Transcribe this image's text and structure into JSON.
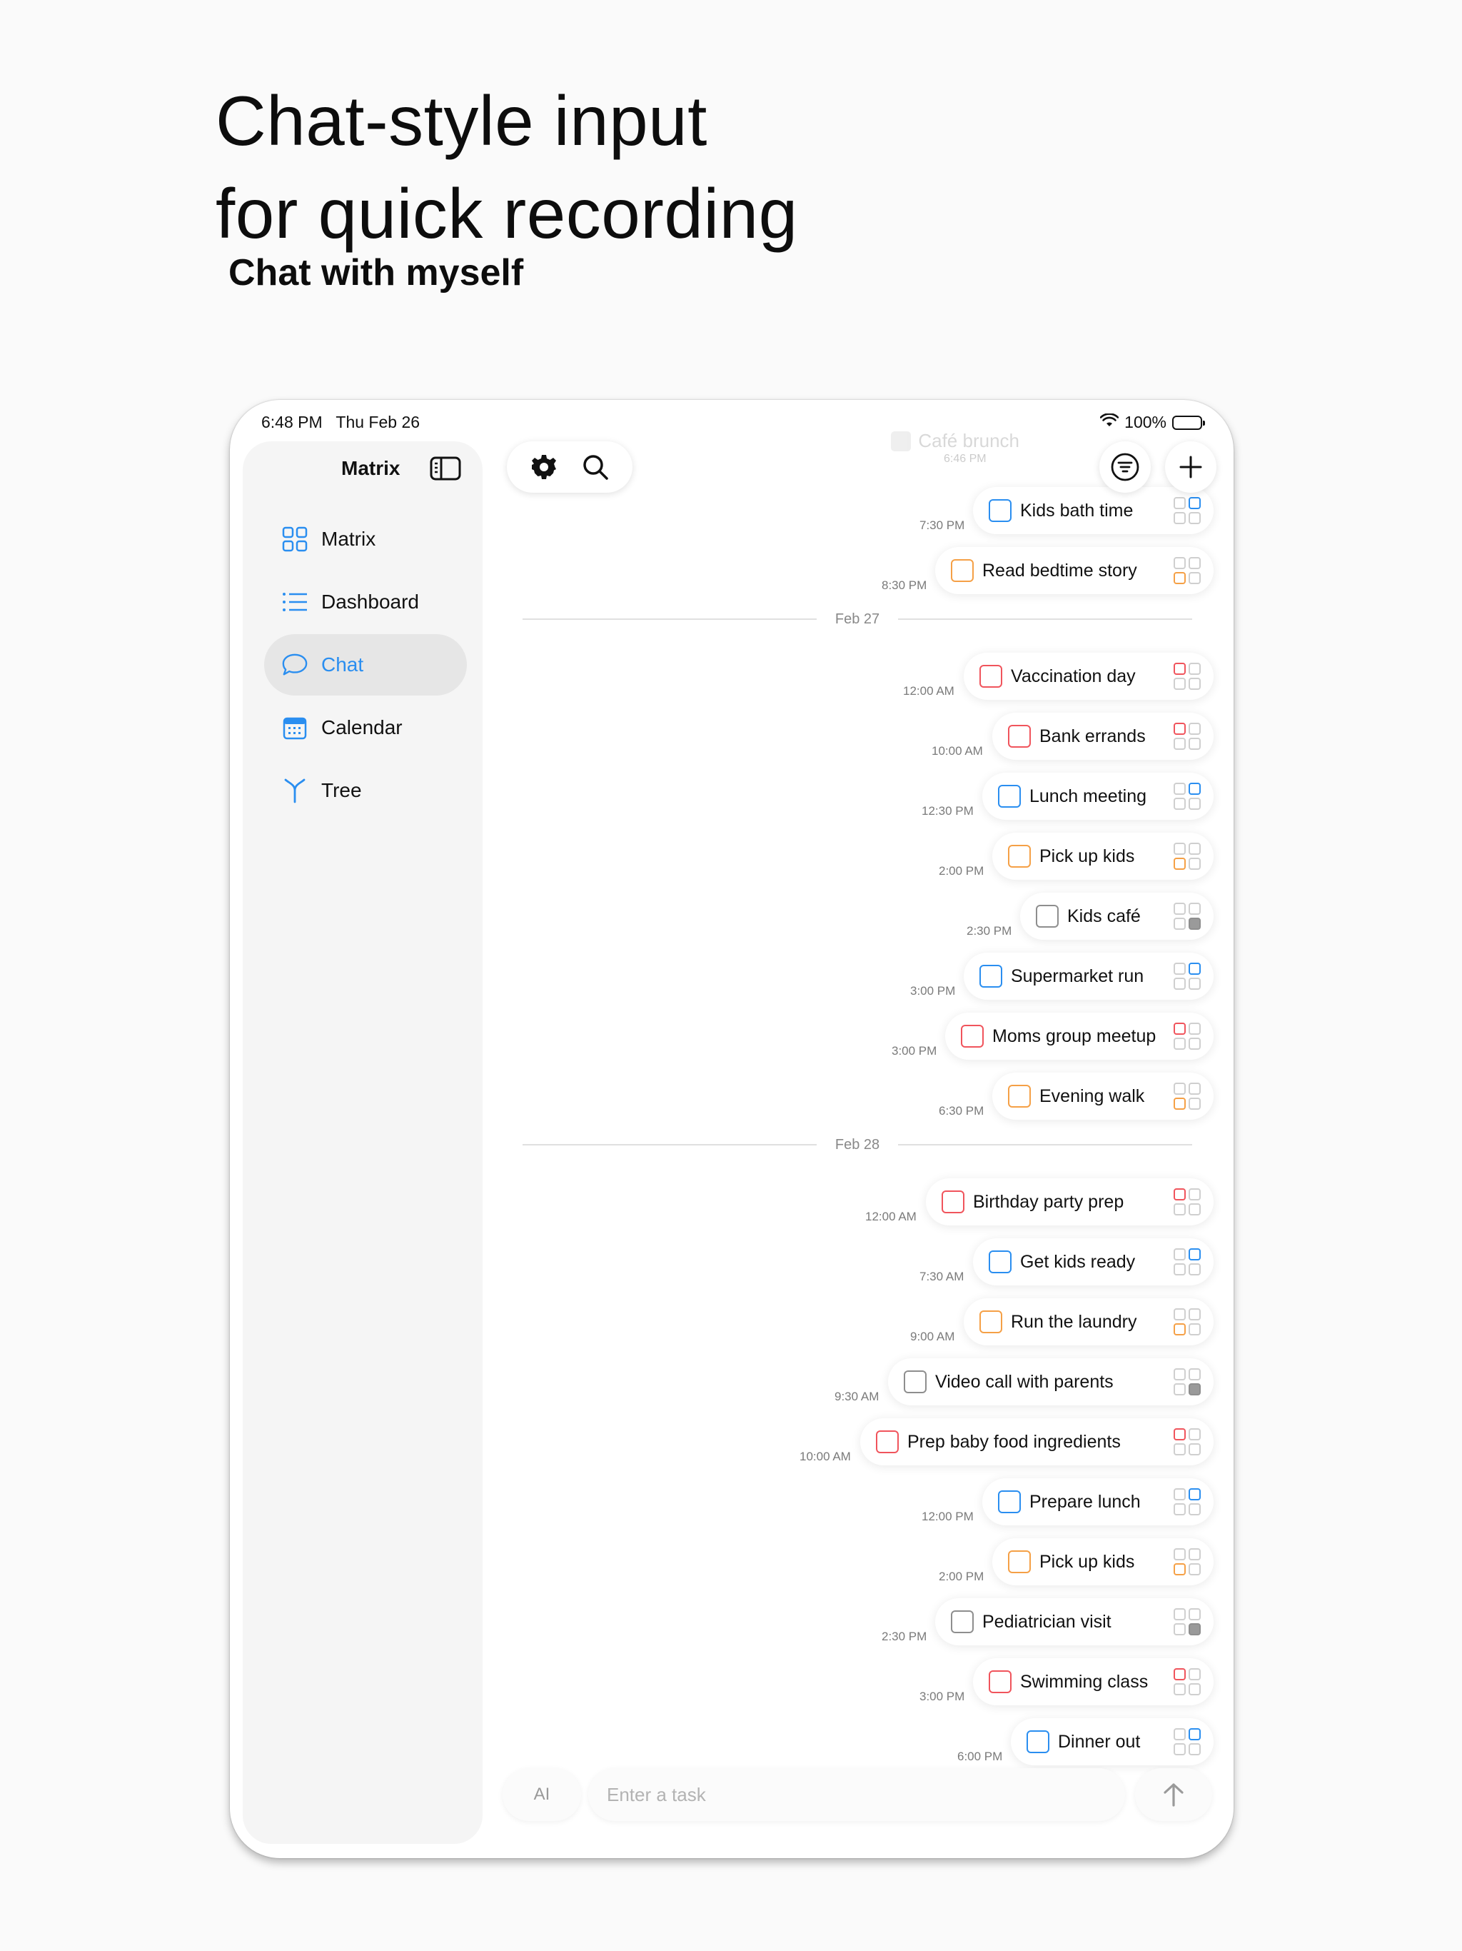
{
  "promo": {
    "headline_line1": "Chat-style input",
    "headline_line2": "for quick recording",
    "subline": "Chat with myself"
  },
  "status_bar": {
    "time": "6:48 PM   Thu Feb 26",
    "battery": "100%"
  },
  "sidebar": {
    "title": "Matrix",
    "items": [
      {
        "label": "Matrix",
        "icon": "grid-icon"
      },
      {
        "label": "Dashboard",
        "icon": "list-icon"
      },
      {
        "label": "Chat",
        "icon": "chat-bubble-icon",
        "active": true
      },
      {
        "label": "Calendar",
        "icon": "calendar-icon"
      },
      {
        "label": "Tree",
        "icon": "tree-branch-icon"
      }
    ]
  },
  "colors": {
    "red": "#f0545c",
    "blue": "#2a8ef0",
    "orange": "#f5a046",
    "gray": "#8e8e8e",
    "accent": "#2a8ef0"
  },
  "chat": {
    "ghost_task": {
      "text": "Café brunch",
      "time": "6:46 PM"
    },
    "groups": [
      {
        "date": "",
        "tasks": [
          {
            "text": "Kids bath time",
            "time": "7:30 PM",
            "color": "blue",
            "quadrant": 1
          },
          {
            "text": "Read bedtime story",
            "time": "8:30 PM",
            "color": "orange",
            "quadrant": 2
          }
        ]
      },
      {
        "date": "Feb 27",
        "tasks": [
          {
            "text": "Vaccination day",
            "time": "12:00 AM",
            "color": "red",
            "quadrant": 0
          },
          {
            "text": "Bank errands",
            "time": "10:00 AM",
            "color": "red",
            "quadrant": 0
          },
          {
            "text": "Lunch meeting",
            "time": "12:30 PM",
            "color": "blue",
            "quadrant": 1
          },
          {
            "text": "Pick up kids",
            "time": "2:00 PM",
            "color": "orange",
            "quadrant": 2
          },
          {
            "text": "Kids café",
            "time": "2:30 PM",
            "color": "gray",
            "quadrant": 3
          },
          {
            "text": "Supermarket run",
            "time": "3:00 PM",
            "color": "blue",
            "quadrant": 1
          },
          {
            "text": "Moms group meetup",
            "time": "3:00 PM",
            "color": "red",
            "quadrant": 0
          },
          {
            "text": "Evening walk",
            "time": "6:30 PM",
            "color": "orange",
            "quadrant": 2
          }
        ]
      },
      {
        "date": "Feb 28",
        "tasks": [
          {
            "text": "Birthday party prep",
            "time": "12:00 AM",
            "color": "red",
            "quadrant": 0
          },
          {
            "text": "Get kids ready",
            "time": "7:30 AM",
            "color": "blue",
            "quadrant": 1
          },
          {
            "text": "Run the laundry",
            "time": "9:00 AM",
            "color": "orange",
            "quadrant": 2
          },
          {
            "text": "Video call with parents",
            "time": "9:30 AM",
            "color": "gray",
            "quadrant": 3
          },
          {
            "text": "Prep baby food ingredients",
            "time": "10:00 AM",
            "color": "red",
            "quadrant": 0
          },
          {
            "text": "Prepare lunch",
            "time": "12:00 PM",
            "color": "blue",
            "quadrant": 1
          },
          {
            "text": "Pick up kids",
            "time": "2:00 PM",
            "color": "orange",
            "quadrant": 2
          },
          {
            "text": "Pediatrician visit",
            "time": "2:30 PM",
            "color": "gray",
            "quadrant": 3
          },
          {
            "text": "Swimming class",
            "time": "3:00 PM",
            "color": "red",
            "quadrant": 0
          },
          {
            "text": "Dinner out",
            "time": "6:00 PM",
            "color": "blue",
            "quadrant": 1
          }
        ]
      }
    ]
  },
  "input_bar": {
    "ai_label": "AI",
    "placeholder": "Enter a task"
  }
}
